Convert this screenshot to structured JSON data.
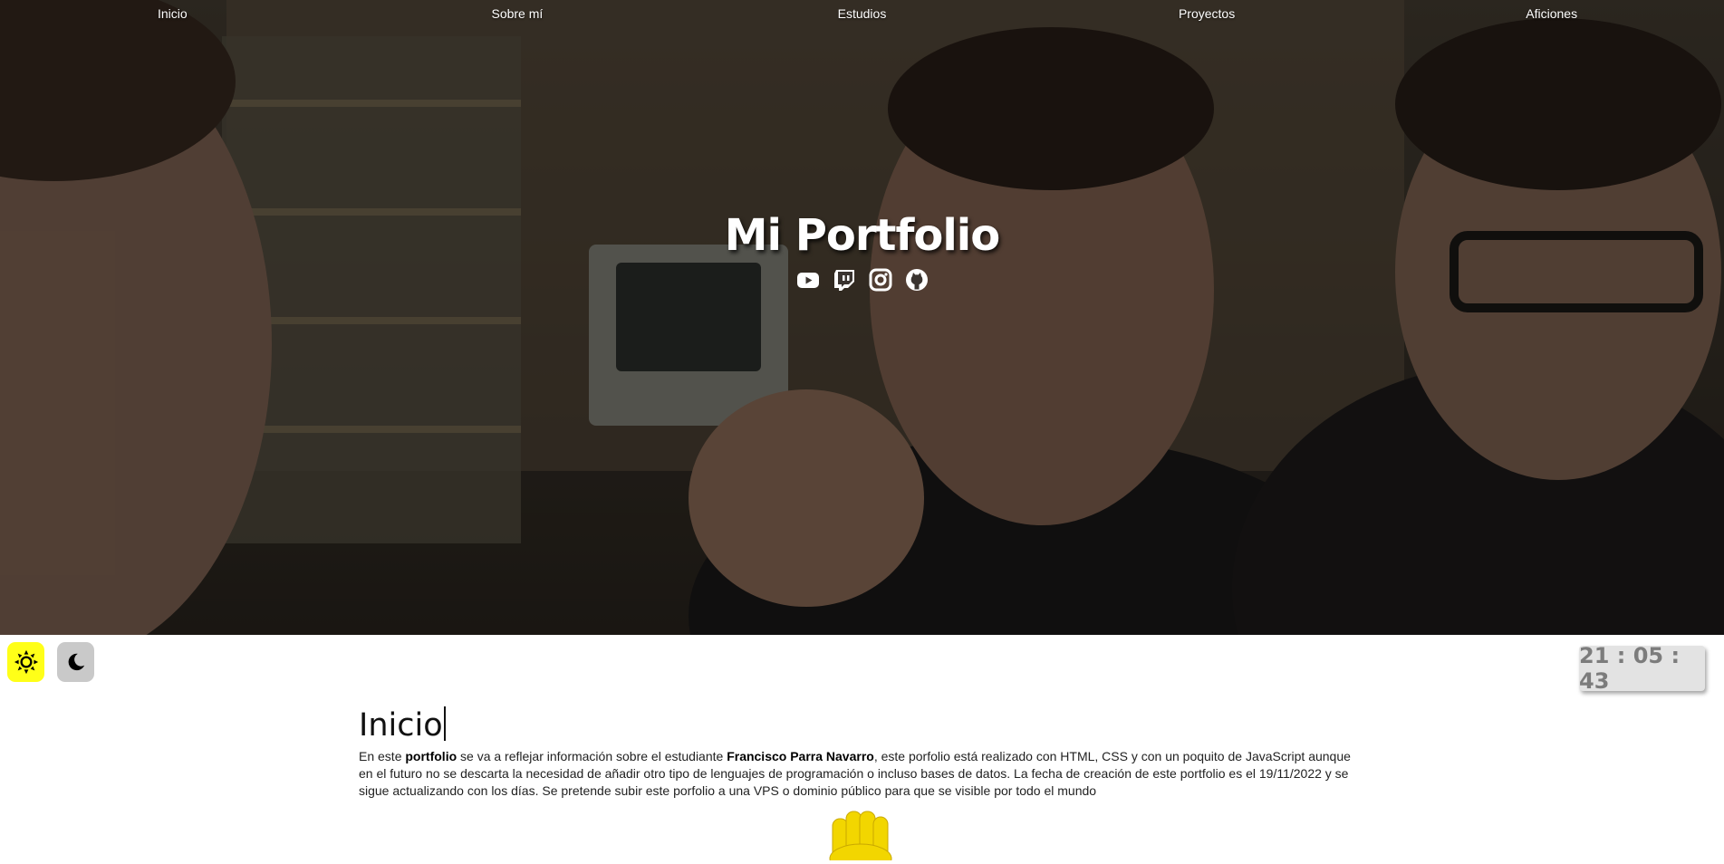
{
  "nav": {
    "items": [
      "Inicio",
      "Sobre mí",
      "Estudios",
      "Proyectos",
      "Aficiones"
    ]
  },
  "hero": {
    "title": "Mi Portfolio",
    "socials": [
      "youtube-icon",
      "twitch-icon",
      "instagram-icon",
      "github-icon"
    ]
  },
  "theme": {
    "light_icon": "sun-icon",
    "dark_icon": "moon-icon",
    "light_color": "#ffff18",
    "dark_color": "#c9c9c9"
  },
  "clock": {
    "time": "21 : 05 : 43"
  },
  "section": {
    "heading": "Inicio",
    "text_1": "En este ",
    "bold_1": "portfolio",
    "text_2": " se va a reflejar información sobre el estudiante ",
    "bold_2": "Francisco Parra Navarro",
    "text_3": ", este porfolio está realizado con HTML, CSS y con un poquito de JavaScript aunque en el futuro no se descarta la necesidad de añadir otro tipo de lenguajes de programación o incluso bases de datos. La fecha de creación de este portfolio es el 19/11/2022 y se sigue actualizando con los días. Se pretende subir este porfolio a una VPS o dominio público para que se visible por todo el mundo"
  },
  "decor": {
    "emoji": "waving-hand-icon",
    "emoji_color": "#f2d600"
  }
}
